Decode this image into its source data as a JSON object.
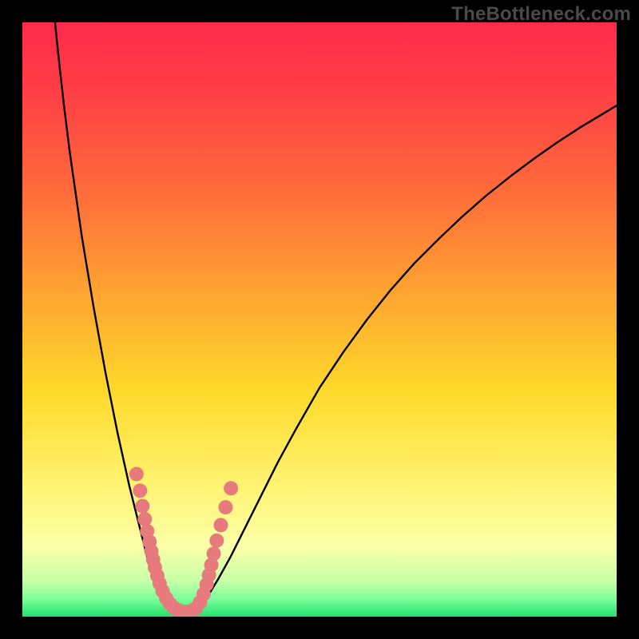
{
  "watermark": "TheBottleneck.com",
  "gradient_stops": [
    {
      "offset": "0%",
      "color": "#ff2a4b"
    },
    {
      "offset": "12%",
      "color": "#ff3f45"
    },
    {
      "offset": "28%",
      "color": "#ff6a3a"
    },
    {
      "offset": "45%",
      "color": "#ffa231"
    },
    {
      "offset": "62%",
      "color": "#ffd92a"
    },
    {
      "offset": "78%",
      "color": "#fff371"
    },
    {
      "offset": "88%",
      "color": "#fbffa7"
    },
    {
      "offset": "94%",
      "color": "#c7ffa8"
    },
    {
      "offset": "97%",
      "color": "#7dff9a"
    },
    {
      "offset": "100%",
      "color": "#25e06d"
    }
  ],
  "marker_color": "#e77a7d",
  "marker_radius": 9,
  "curve_stroke": "#000000",
  "chart_data": {
    "type": "line",
    "title": "",
    "xlabel": "",
    "ylabel": "",
    "x_range": [
      0,
      100
    ],
    "y_range": [
      0,
      100
    ],
    "grid": false,
    "series": [
      {
        "name": "bottleneck-curve",
        "x": [
          5.5,
          6,
          7,
          8,
          9,
          10,
          11,
          12,
          13,
          14,
          15,
          16,
          17,
          18,
          19,
          20,
          20.5,
          21,
          21.5,
          22,
          22.5,
          23,
          23.5,
          24,
          25,
          26,
          27,
          28,
          29,
          30,
          31,
          33,
          35,
          37,
          40,
          43,
          46,
          50,
          54,
          58,
          62,
          66,
          70,
          74,
          78,
          82,
          86,
          90,
          94,
          98,
          100
        ],
        "values": [
          100,
          95,
          86,
          78,
          71,
          64,
          58,
          52,
          46.5,
          41,
          36,
          31,
          26.5,
          22,
          18,
          14,
          12,
          10,
          8.4,
          6.8,
          5.4,
          4.2,
          3.2,
          2.4,
          1.3,
          0.7,
          0.4,
          0.4,
          0.9,
          1.8,
          3.1,
          6.4,
          10,
          14,
          20,
          26,
          31.5,
          38.5,
          44.5,
          50,
          55,
          59.5,
          63.5,
          67.3,
          70.8,
          74,
          77,
          79.8,
          82.4,
          84.8,
          86
        ]
      }
    ],
    "markers": {
      "name": "sample-points",
      "x_pct": [
        19.2,
        19.8,
        20.2,
        20.6,
        21.0,
        21.4,
        21.7,
        22.0,
        22.3,
        22.7,
        23.1,
        23.6,
        24.2,
        24.8,
        25.5,
        26.4,
        27.3,
        28.3,
        29.2,
        29.9,
        30.5,
        31.0,
        31.4,
        31.8,
        32.2,
        32.7,
        33.4,
        34.2,
        35.1
      ],
      "y_pct": [
        24.0,
        21.2,
        18.6,
        16.4,
        14.4,
        12.6,
        11.0,
        9.6,
        8.3,
        6.9,
        5.6,
        4.3,
        3.1,
        2.2,
        1.5,
        1.0,
        0.8,
        0.9,
        1.4,
        2.4,
        3.8,
        5.4,
        7.0,
        8.7,
        10.6,
        12.8,
        15.4,
        18.4,
        21.6
      ]
    }
  }
}
